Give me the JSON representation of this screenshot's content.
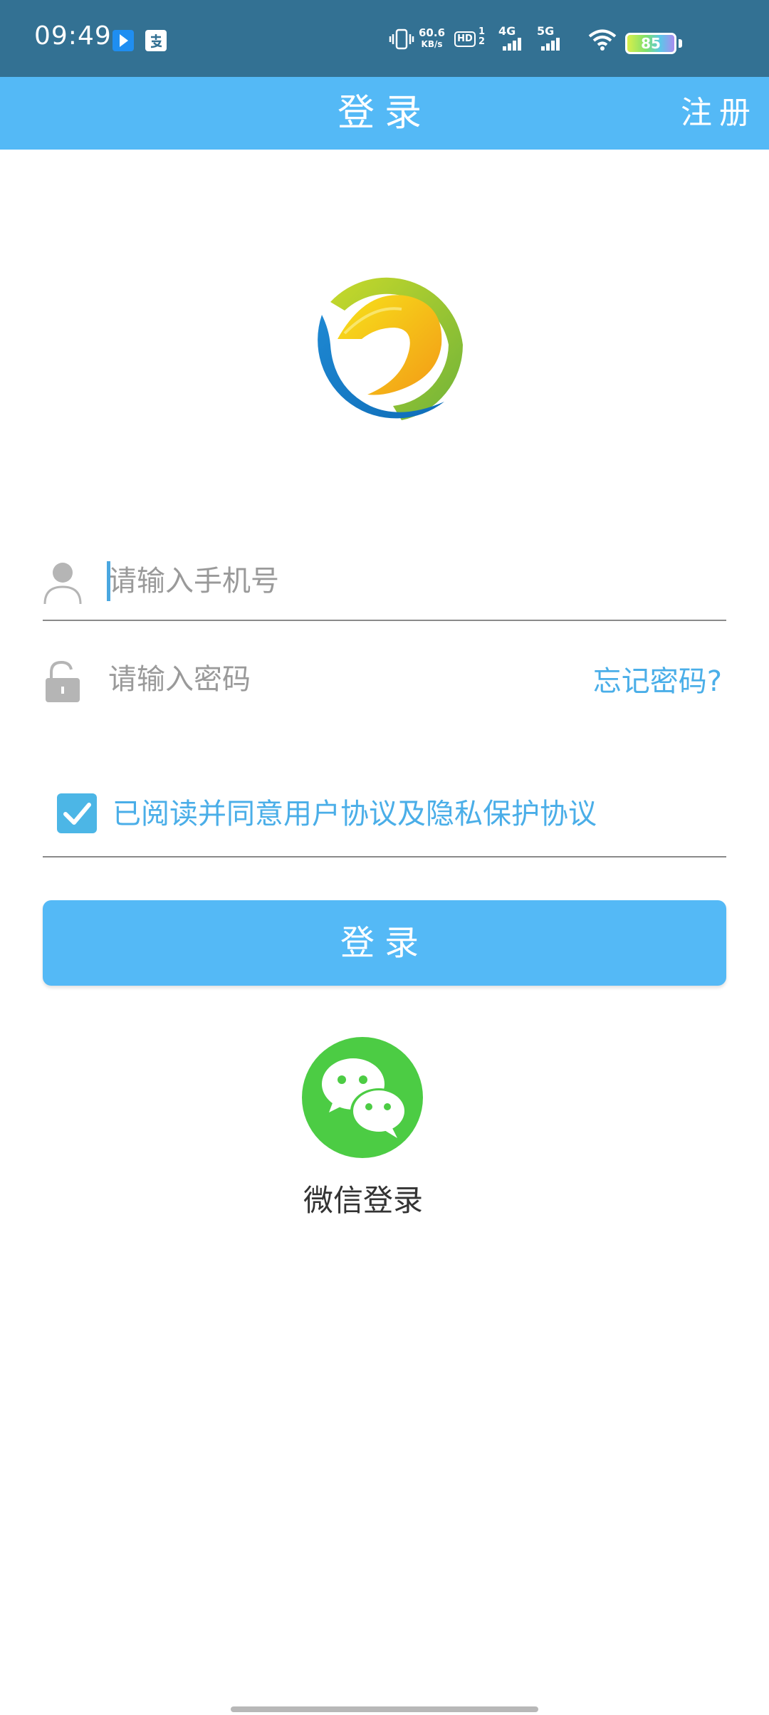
{
  "status_bar": {
    "time": "09:49",
    "net_speed_value": "60.6",
    "net_speed_unit": "KB/s",
    "hd": "HD",
    "hd_sims": "1\n2",
    "signal_1": "4G",
    "signal_2": "5G",
    "battery": "85"
  },
  "header": {
    "title": "登录",
    "register": "注册"
  },
  "form": {
    "phone_placeholder": "请输入手机号",
    "password_placeholder": "请输入密码",
    "forgot_label": "忘记密码?",
    "agreement_text": "已阅读并同意用户协议及隐私保护协议",
    "agreement_checked": true,
    "login_label": "登录"
  },
  "wechat": {
    "label": "微信登录"
  },
  "colors": {
    "status_bar": "#337193",
    "accent": "#54b9f6",
    "link": "#4aaee8",
    "wechat_green": "#4ccc44"
  }
}
